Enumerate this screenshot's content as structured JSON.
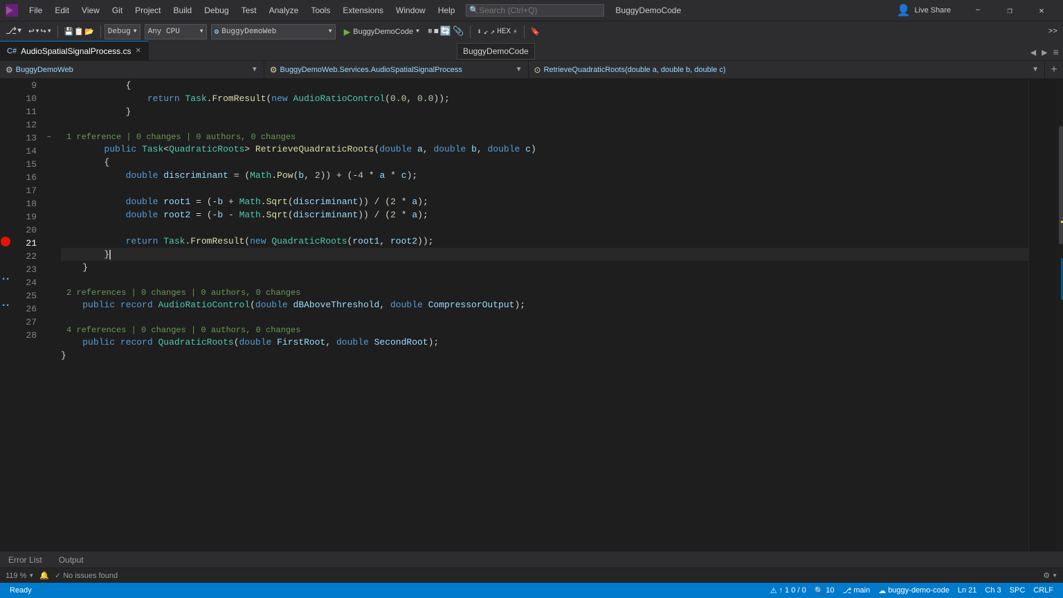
{
  "titleBar": {
    "appName": "BuggyDemoCode",
    "menuItems": [
      "File",
      "Edit",
      "View",
      "Git",
      "Project",
      "Build",
      "Debug",
      "Test",
      "Analyze",
      "Tools",
      "Extensions",
      "Window",
      "Help"
    ],
    "searchPlaceholder": "Search (Ctrl+Q)",
    "liveShare": "Live Share",
    "windowControls": [
      "−",
      "❐",
      "✕"
    ]
  },
  "toolbar": {
    "undoRedo": [
      "◀",
      "▶"
    ],
    "buildConfig": "Debug",
    "platform": "Any CPU",
    "projectName": "BuggyDemoWeb",
    "playLabel": "BuggyDemoCode",
    "tooltipText": "BuggyDemoCode"
  },
  "tabBar": {
    "tabs": [
      {
        "name": "AudioSpatialSignalProcess.cs",
        "active": true
      },
      {
        "name": "×",
        "active": false
      }
    ],
    "icons": [
      "◀",
      "▶",
      "↕"
    ]
  },
  "navBar": {
    "namespace": "BuggyDemoWeb",
    "service": "BuggyDemoWeb.Services.AudioSpatialSignalProcess",
    "method": "RetrieveQuadraticRoots(double a, double b, double c)"
  },
  "codeLines": [
    {
      "num": 9,
      "indent": 3,
      "content": "{",
      "type": "plain"
    },
    {
      "num": 10,
      "indent": 4,
      "content": "return Task.FromResult(new AudioRatioControl(0.0, 0.0));",
      "type": "code"
    },
    {
      "num": 11,
      "indent": 3,
      "content": "}",
      "type": "plain"
    },
    {
      "num": 12,
      "indent": 0,
      "content": "",
      "type": "plain"
    },
    {
      "num": 13,
      "indent": 2,
      "content": "public Task<QuadraticRoots> RetrieveQuadraticRoots(double a, double b, double c)",
      "type": "code",
      "refInfo": "1 reference | 0 changes | 0 authors, 0 changes",
      "hasCollapse": true
    },
    {
      "num": 14,
      "indent": 2,
      "content": "{",
      "type": "plain"
    },
    {
      "num": 15,
      "indent": 3,
      "content": "double discriminant = (Math.Pow(b, 2)) + (-4 * a * c);",
      "type": "code"
    },
    {
      "num": 16,
      "indent": 0,
      "content": "",
      "type": "plain"
    },
    {
      "num": 17,
      "indent": 3,
      "content": "double root1 = (-b + Math.Sqrt(discriminant)) / (2 * a);",
      "type": "code"
    },
    {
      "num": 18,
      "indent": 3,
      "content": "double root2 = (-b - Math.Sqrt(discriminant)) / (2 * a);",
      "type": "code"
    },
    {
      "num": 19,
      "indent": 0,
      "content": "",
      "type": "plain"
    },
    {
      "num": 20,
      "indent": 3,
      "content": "return Task.FromResult(new QuadraticRoots(root1, root2));",
      "type": "code"
    },
    {
      "num": 21,
      "indent": 2,
      "content": "}",
      "type": "code",
      "isCurrent": true,
      "hasBreakpoint": false,
      "hasCursor": true
    },
    {
      "num": 22,
      "indent": 2,
      "content": "}",
      "type": "plain"
    },
    {
      "num": 23,
      "indent": 0,
      "content": "",
      "type": "plain"
    },
    {
      "num": 24,
      "indent": 2,
      "content": "public record AudioRatioControl(double dBAboveThreshold, double CompressorOutput);",
      "type": "code",
      "refInfo": "2 references | 0 changes | 0 authors, 0 changes",
      "hasBreakpointIcon": true
    },
    {
      "num": 25,
      "indent": 0,
      "content": "",
      "type": "plain"
    },
    {
      "num": 26,
      "indent": 2,
      "content": "public record QuadraticRoots(double FirstRoot, double SecondRoot);",
      "type": "code",
      "refInfo": "4 references | 0 changes | 0 authors, 0 changes",
      "hasBreakpointIcon": true
    },
    {
      "num": 27,
      "indent": 2,
      "content": "}",
      "type": "plain"
    },
    {
      "num": 28,
      "indent": 0,
      "content": "",
      "type": "plain"
    }
  ],
  "statusBar": {
    "ready": "Ready",
    "errors": "↑ 1",
    "errCount": "0 / 0",
    "zoom": "10",
    "branch": "main",
    "branchIcon": "⎇",
    "repo": "buggy-demo-code",
    "repoIcon": "☁"
  },
  "bottomBar": {
    "zoomLevel": "119 %",
    "notifyIcon": "🔔",
    "noIssues": "No issues found",
    "checkIcon": "✓",
    "rightItems": [
      "Ln 21",
      "Ch 3",
      "SPC",
      "CRLF"
    ],
    "panelTabs": [
      "Error List",
      "Output"
    ]
  }
}
